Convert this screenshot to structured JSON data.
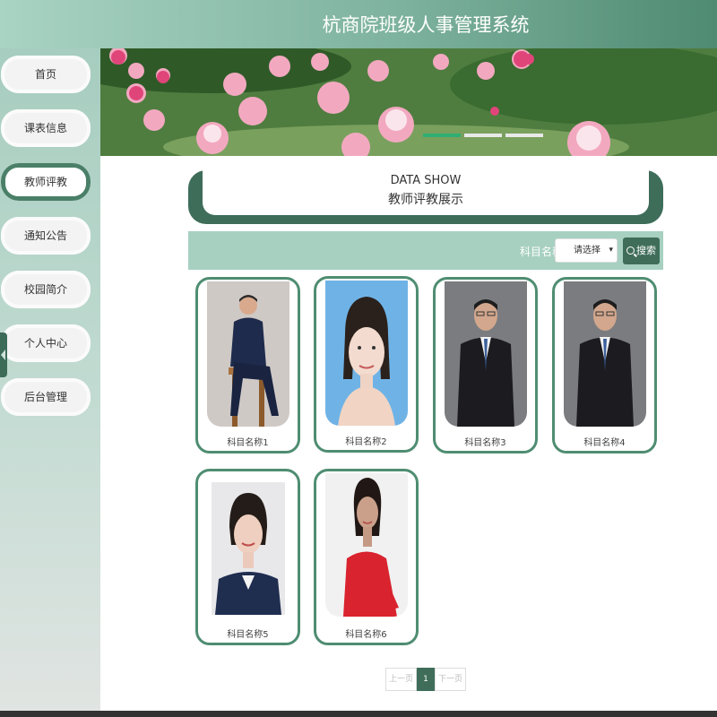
{
  "header": {
    "title": "杭商院班级人事管理系统"
  },
  "sidebar": {
    "items": [
      {
        "label": "首页",
        "active": false
      },
      {
        "label": "课表信息",
        "active": false
      },
      {
        "label": "教师评教",
        "active": true
      },
      {
        "label": "通知公告",
        "active": false
      },
      {
        "label": "校园简介",
        "active": false
      },
      {
        "label": "个人中心",
        "active": false
      },
      {
        "label": "后台管理",
        "active": false
      }
    ]
  },
  "banner": {
    "slide_count": 3,
    "active_slide": 1
  },
  "section": {
    "en_title": "DATA SHOW",
    "cn_title": "教师评教展示"
  },
  "search": {
    "label": "科目名称",
    "select_value": "请选择",
    "button_label": "搜索"
  },
  "cards": [
    {
      "caption": "科目名称1"
    },
    {
      "caption": "科目名称2"
    },
    {
      "caption": "科目名称3"
    },
    {
      "caption": "科目名称4"
    },
    {
      "caption": "科目名称5"
    },
    {
      "caption": "科目名称6"
    }
  ],
  "pagination": {
    "prev": "上一页",
    "current": "1",
    "next": "下一页"
  },
  "colors": {
    "accent": "#3f6d59",
    "header_light": "#a9d3c3",
    "active_dot": "#2fae74"
  }
}
